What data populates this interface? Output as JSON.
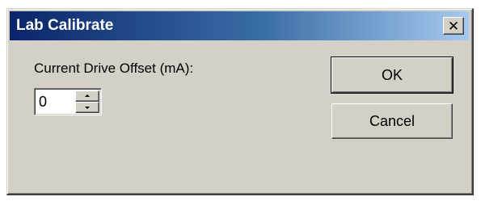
{
  "window": {
    "title": "Lab Calibrate",
    "close_label": "✕"
  },
  "form": {
    "offset_label": "Current Drive Offset (mA):",
    "offset_value": "0"
  },
  "buttons": {
    "ok_label": "OK",
    "cancel_label": "Cancel"
  },
  "colors": {
    "face": "#d4d0c8",
    "title_start": "#0a246a",
    "title_end": "#a6caf0"
  },
  "icons": {
    "close": "close-icon",
    "spin_up": "spin-up-arrow-icon",
    "spin_down": "spin-down-arrow-icon"
  }
}
